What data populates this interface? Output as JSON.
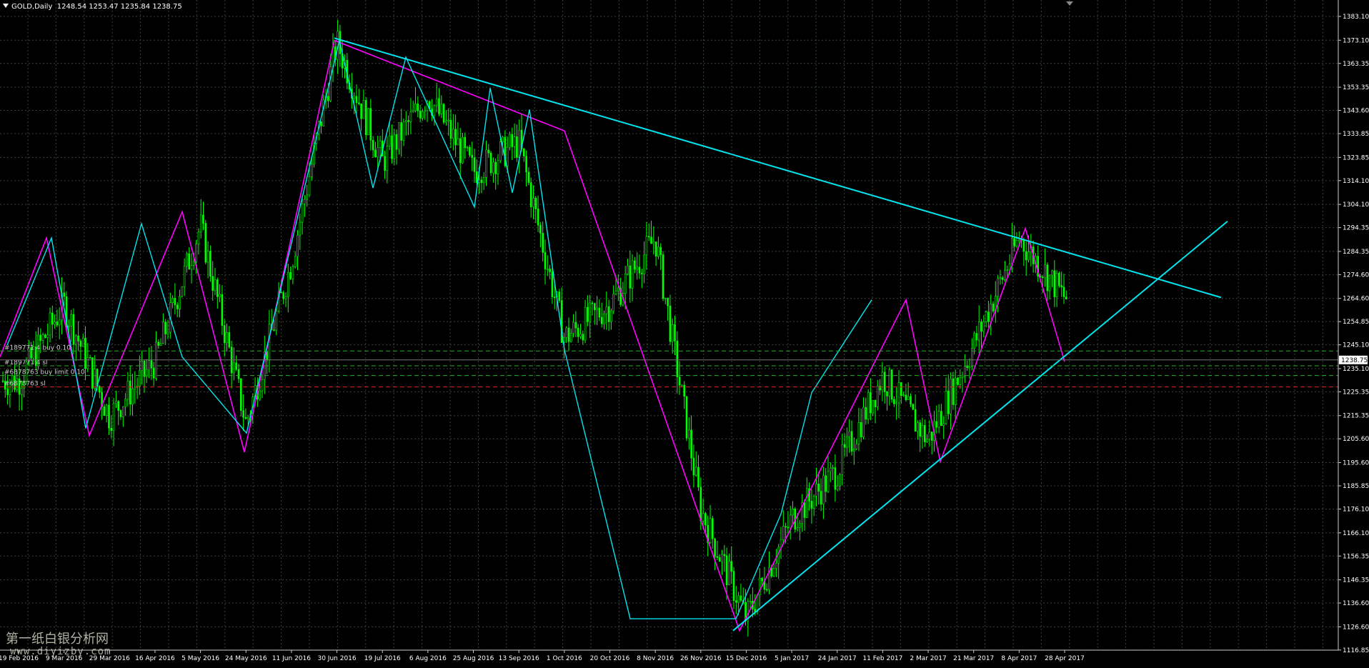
{
  "window": {
    "symbol_label": "GOLD,Daily",
    "ohlc_text": "1248.54 1253.47 1235.84 1238.75",
    "watermark_cn": "第一纸白银分析网",
    "watermark_url": "www.diyizby.com"
  },
  "colors": {
    "background": "#000000",
    "grid": "#37443c",
    "candles": "#00ff00",
    "zigzag_major": "#ff00ff",
    "zigzag_minor": "#00e5ee",
    "trendlines": "#00e5ee",
    "order_lines": "#22aa22",
    "sl_line": "#dd2222",
    "price_marker_bg": "#ffffff"
  },
  "orders": [
    {
      "label": "#189771 4 buy 0.10",
      "price": 1242.5,
      "style": "dashed",
      "color": "green"
    },
    {
      "label": "#189771 4 sl",
      "price": 1236.3,
      "style": "dashed",
      "color": "green"
    },
    {
      "label": "#6878763 buy limit 0.10",
      "price": 1232.2,
      "style": "dashed",
      "color": "green"
    },
    {
      "label": "#6878763 sl",
      "price": 1227.4,
      "style": "dashed",
      "color": "red"
    }
  ],
  "current_price": "1238.75",
  "chart_data": {
    "type": "candlestick",
    "instrument": "GOLD",
    "timeframe": "Daily",
    "ylim": [
      1116.8,
      1390.0
    ],
    "y_ticks": [
      "1383.10",
      "1373.10",
      "1363.35",
      "1353.35",
      "1343.60",
      "1333.85",
      "1323.85",
      "1314.10",
      "1304.10",
      "1294.35",
      "1284.35",
      "1274.60",
      "1264.60",
      "1254.85",
      "1245.10",
      "1235.10",
      "1225.35",
      "1215.35",
      "1205.60",
      "1195.60",
      "1185.85",
      "1176.10",
      "1166.10",
      "1156.35",
      "1146.35",
      "1136.60",
      "1126.60",
      "1116.85"
    ],
    "x_ticks": [
      "19 Feb 2016",
      "9 Mar 2016",
      "29 Mar 2016",
      "16 Apr 2016",
      "5 May 2016",
      "24 May 2016",
      "11 Jun 2016",
      "30 Jun 2016",
      "19 Jul 2016",
      "6 Aug 2016",
      "25 Aug 2016",
      "13 Sep 2016",
      "1 Oct 2016",
      "20 Oct 2016",
      "8 Nov 2016",
      "26 Nov 2016",
      "15 Dec 2016",
      "5 Jan 2017",
      "24 Jan 2017",
      "11 Feb 2017",
      "2 Mar 2017",
      "21 Mar 2017",
      "8 Apr 2017",
      "28 Apr 2017"
    ],
    "price_path": [
      [
        "19 Feb 2016",
        1230
      ],
      [
        "9 Mar 2016",
        1262
      ],
      [
        "29 Mar 2016",
        1215
      ],
      [
        "16 Apr 2016",
        1238
      ],
      [
        "5 May 2016",
        1295
      ],
      [
        "24 May 2016",
        1212
      ],
      [
        "11 Jun 2016",
        1280
      ],
      [
        "30 Jun 2016",
        1372
      ],
      [
        "19 Jul 2016",
        1322
      ],
      [
        "6 Aug 2016",
        1350
      ],
      [
        "25 Aug 2016",
        1318
      ],
      [
        "13 Sep 2016",
        1330
      ],
      [
        "1 Oct 2016",
        1248
      ],
      [
        "20 Oct 2016",
        1262
      ],
      [
        "8 Nov 2016",
        1290
      ],
      [
        "26 Nov 2016",
        1176
      ],
      [
        "15 Dec 2016",
        1130
      ],
      [
        "5 Jan 2017",
        1172
      ],
      [
        "24 Jan 2017",
        1192
      ],
      [
        "11 Feb 2017",
        1232
      ],
      [
        "2 Mar 2017",
        1205
      ],
      [
        "21 Mar 2017",
        1245
      ],
      [
        "8 Apr 2017",
        1290
      ],
      [
        "28 Apr 2017",
        1265
      ]
    ],
    "zigzag_major": [
      [
        0,
        1240
      ],
      [
        65,
        1290
      ],
      [
        125,
        1207
      ],
      [
        255,
        1301
      ],
      [
        342,
        1200
      ],
      [
        468,
        1373
      ],
      [
        790,
        1335
      ],
      [
        1035,
        1125
      ],
      [
        1268,
        1264
      ],
      [
        1316,
        1196
      ],
      [
        1435,
        1294
      ],
      [
        1490,
        1238
      ]
    ],
    "zigzag_minor": [
      [
        10,
        1245
      ],
      [
        72,
        1290
      ],
      [
        120,
        1210
      ],
      [
        198,
        1296
      ],
      [
        255,
        1240
      ],
      [
        345,
        1208
      ],
      [
        475,
        1373
      ],
      [
        522,
        1311
      ],
      [
        568,
        1366
      ],
      [
        664,
        1303
      ],
      [
        686,
        1353
      ],
      [
        717,
        1309
      ],
      [
        741,
        1344
      ],
      [
        790,
        1243
      ],
      [
        882,
        1130
      ],
      [
        1030,
        1130
      ],
      [
        1093,
        1174
      ],
      [
        1136,
        1225
      ],
      [
        1220,
        1264
      ]
    ],
    "trendlines": [
      {
        "from": [
          468,
          1374
        ],
        "to": [
          1709,
          1265
        ]
      },
      {
        "from": [
          1026,
          1125
        ],
        "to": [
          1718,
          1297
        ]
      }
    ]
  }
}
